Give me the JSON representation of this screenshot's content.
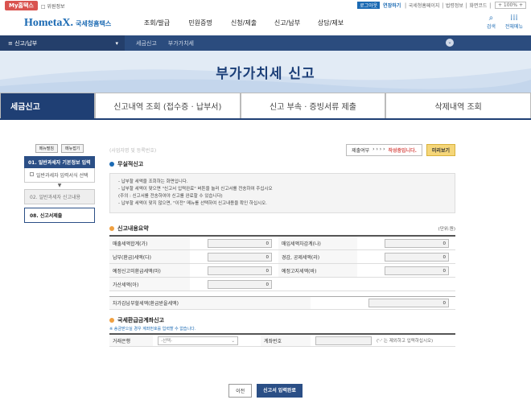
{
  "top": {
    "myhome": "My홈택스",
    "menu_blur": "□ 위원정보",
    "login": "로그아웃",
    "join": "연장하기",
    "links": "│ 국세청홈페이지 │ 법령정보 │ 화면코드 │",
    "zoom": "+ 100% +"
  },
  "header": {
    "logo": "HometaX.",
    "logo_sub": "국세청홈택스",
    "gnb": [
      "조회/발급",
      "민원증명",
      "신청/제출",
      "신고/납부",
      "상담/제보"
    ],
    "search_label": "검색",
    "allmenu_label": "전체메뉴"
  },
  "lnb": {
    "menu": "≡ 신고/납부",
    "crumb1": "세금신고",
    "crumb2": "부가가치세"
  },
  "banner": {
    "title": "부가가치세 신고"
  },
  "tabs": [
    "세금신고",
    "신고내역 조회 (접수증 · 납부서)",
    "신고 부속 · 증빙서류 제출",
    "삭제내역 조회"
  ],
  "side": {
    "btn_expand": "메뉴펼침",
    "btn_collapse": "메뉴접기",
    "item1": "01. 일반과세자 기본정보 입력",
    "sub1": "일반과세자 입력서식 선택",
    "item2": "02. 일반과세자 신고내용",
    "item3": "08. 신고서제출"
  },
  "main": {
    "blurred": "(사업자명 및 등록번호)",
    "status_label": "제출여부",
    "status_arrows": "› › › ›",
    "status_value": "작성중입니다.",
    "preview": "미리보기"
  },
  "section1": {
    "title": "무실적신고",
    "notice": [
      "- 납부할 세액을 조회하는 화면입니다.",
      "- 납부할 세액이 맞으면 \"신고서 입력완료\" 버튼을 눌러 신고서를 전송하여 주십시오",
      "  (주의 : 신고서를 전송하여야 신고를 완료할 수 있습니다)",
      "- 납부할 세액이 맞지 않으면, \"이전\" 메뉴를 선택하여 신고내용을 확인 하십시오."
    ]
  },
  "summary": {
    "title": "신고내용요약",
    "unit": "(단위:원)",
    "rows": [
      {
        "l1": "매출세액합계(가)",
        "v1": "0",
        "l2": "매입세액차감계(나)",
        "v2": "0"
      },
      {
        "l1": "납부(환급)세액(다)",
        "v1": "0",
        "l2": "경감, 공제세액(라)",
        "v2": "0"
      },
      {
        "l1": "예정신고미환급세액(마)",
        "v1": "0",
        "l2": "예정고지세액(바)",
        "v2": "0"
      },
      {
        "l1": "가산세액(아)",
        "v1": "0",
        "l2": "",
        "v2": ""
      }
    ],
    "total_label": "차가감납부할세액(환급받을세액)",
    "total_value": "0"
  },
  "refund": {
    "title": "국세환급금계좌신고",
    "note": "※ 송금받으실 경우 계좌번호를 입력할 수 없습니다.",
    "bank_label": "거래은행",
    "bank_placeholder": "-선택-",
    "account_label": "계좌번호",
    "account_hint": "('-' 는 제외하고 입력하십시오)"
  },
  "buttons": {
    "prev": "이전",
    "submit": "신고서 입력완료"
  }
}
